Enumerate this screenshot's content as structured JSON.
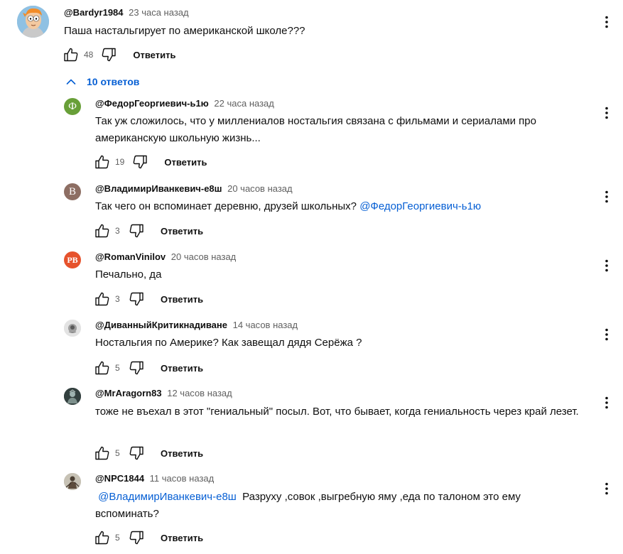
{
  "colors": {
    "text": "#0f0f0f",
    "secondary": "#606060",
    "link": "#065fd4"
  },
  "top_comment": {
    "author": "@Bardyr1984",
    "time": "23 часа назад",
    "text": "Паша настальгирует по американской школе???",
    "likes": "48",
    "reply_label": "Ответить",
    "avatar_icon": "cartoon-avatar-icon"
  },
  "replies_toggle": {
    "label": "10 ответов",
    "icon": "chevron-up-icon"
  },
  "replies": [
    {
      "author": "@ФедорГеоргиевич-ь1ю",
      "time": "22 часа назад",
      "mention": "",
      "text": "Так уж сложилось, что у миллениалов ностальгия связана с фильмами и сериалами про американскую школьную жизнь...",
      "trailing_mention": "",
      "likes": "19",
      "reply_label": "Ответить",
      "avatar_letter": "Ф",
      "avatar_color": "#689f38"
    },
    {
      "author": "@ВладимирИванкевич-е8ш",
      "time": "20 часов назад",
      "mention": "",
      "text": "Так чего он вспоминает деревню, друзей школьных? ",
      "trailing_mention": "@ФедорГеоргиевич-ь1ю",
      "likes": "3",
      "reply_label": "Ответить",
      "avatar_letter": "В",
      "avatar_color": "#8d6e63"
    },
    {
      "author": "@RomanVinilov",
      "time": "20 часов назад",
      "mention": "",
      "text": "Печально, да",
      "trailing_mention": "",
      "likes": "3",
      "reply_label": "Ответить",
      "avatar_letter": "РВ",
      "avatar_color": "#e6522c"
    },
    {
      "author": "@ДиванныйКритикнадиване",
      "time": "14 часов назад",
      "mention": "",
      "text": "Ностальгия по Америке? Как завещал дядя Серёжа ?",
      "trailing_mention": "",
      "likes": "5",
      "reply_label": "Ответить",
      "avatar_icon": "round-photo-avatar-icon"
    },
    {
      "author": "@MrAragorn83",
      "time": "12 часов назад",
      "mention": "",
      "text": "тоже не въехал в этот \"гениальный\" посыл. Вот, что бывает, когда гениальность через край лезет.",
      "trailing_mention": "",
      "likes": "5",
      "reply_label": "Ответить",
      "avatar_icon": "dark-figure-avatar-icon"
    },
    {
      "author": "@NPC1844",
      "time": "11 часов назад",
      "mention": "@ВладимирИванкевич-е8ш",
      "text": "  Разруху ,совок ,выгребную яму ,еда по талоном это ему вспоминать?",
      "trailing_mention": "",
      "likes": "5",
      "reply_label": "Ответить",
      "avatar_icon": "warrior-avatar-icon"
    }
  ]
}
